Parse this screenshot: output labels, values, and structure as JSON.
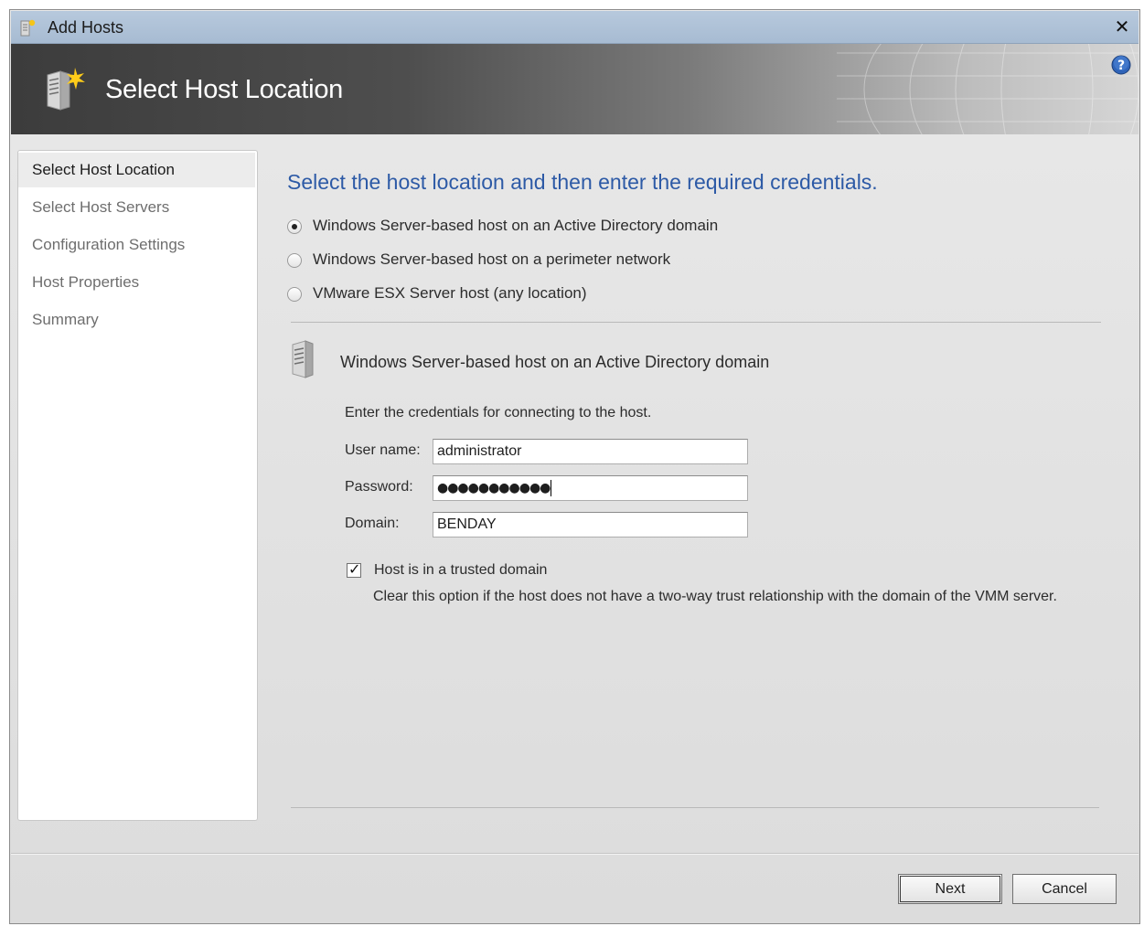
{
  "window": {
    "title": "Add Hosts"
  },
  "banner": {
    "title": "Select Host Location"
  },
  "nav": {
    "items": [
      {
        "label": "Select Host Location",
        "active": true
      },
      {
        "label": "Select Host Servers",
        "active": false
      },
      {
        "label": "Configuration Settings",
        "active": false
      },
      {
        "label": "Host Properties",
        "active": false
      },
      {
        "label": "Summary",
        "active": false
      }
    ]
  },
  "main": {
    "heading": "Select the host location and then enter the required credentials.",
    "location_options": [
      {
        "label": "Windows Server-based host on an Active Directory domain",
        "selected": true
      },
      {
        "label": "Windows Server-based host on a perimeter network",
        "selected": false
      },
      {
        "label": "VMware ESX Server host (any location)",
        "selected": false
      }
    ],
    "section_title": "Windows Server-based host on an Active Directory domain",
    "credentials_intro": "Enter the credentials for connecting to the host.",
    "fields": {
      "username_label": "User name:",
      "username_value": "administrator",
      "password_label": "Password:",
      "password_value": "●●●●●●●●●●●",
      "domain_label": "Domain:",
      "domain_value": "BENDAY"
    },
    "trusted_domain": {
      "label": "Host is in a trusted domain",
      "checked": true,
      "help": "Clear this option if the host does not have a two-way trust relationship with the domain of the VMM server."
    }
  },
  "footer": {
    "next_label": "Next",
    "cancel_label": "Cancel"
  },
  "colors": {
    "heading": "#2d5aa6",
    "titlebar": "#b7c9dd",
    "banner_dark": "#3c3c3c"
  },
  "icons": [
    "add-host-icon",
    "close-icon",
    "server-icon",
    "help-icon",
    "server-small-icon"
  ]
}
